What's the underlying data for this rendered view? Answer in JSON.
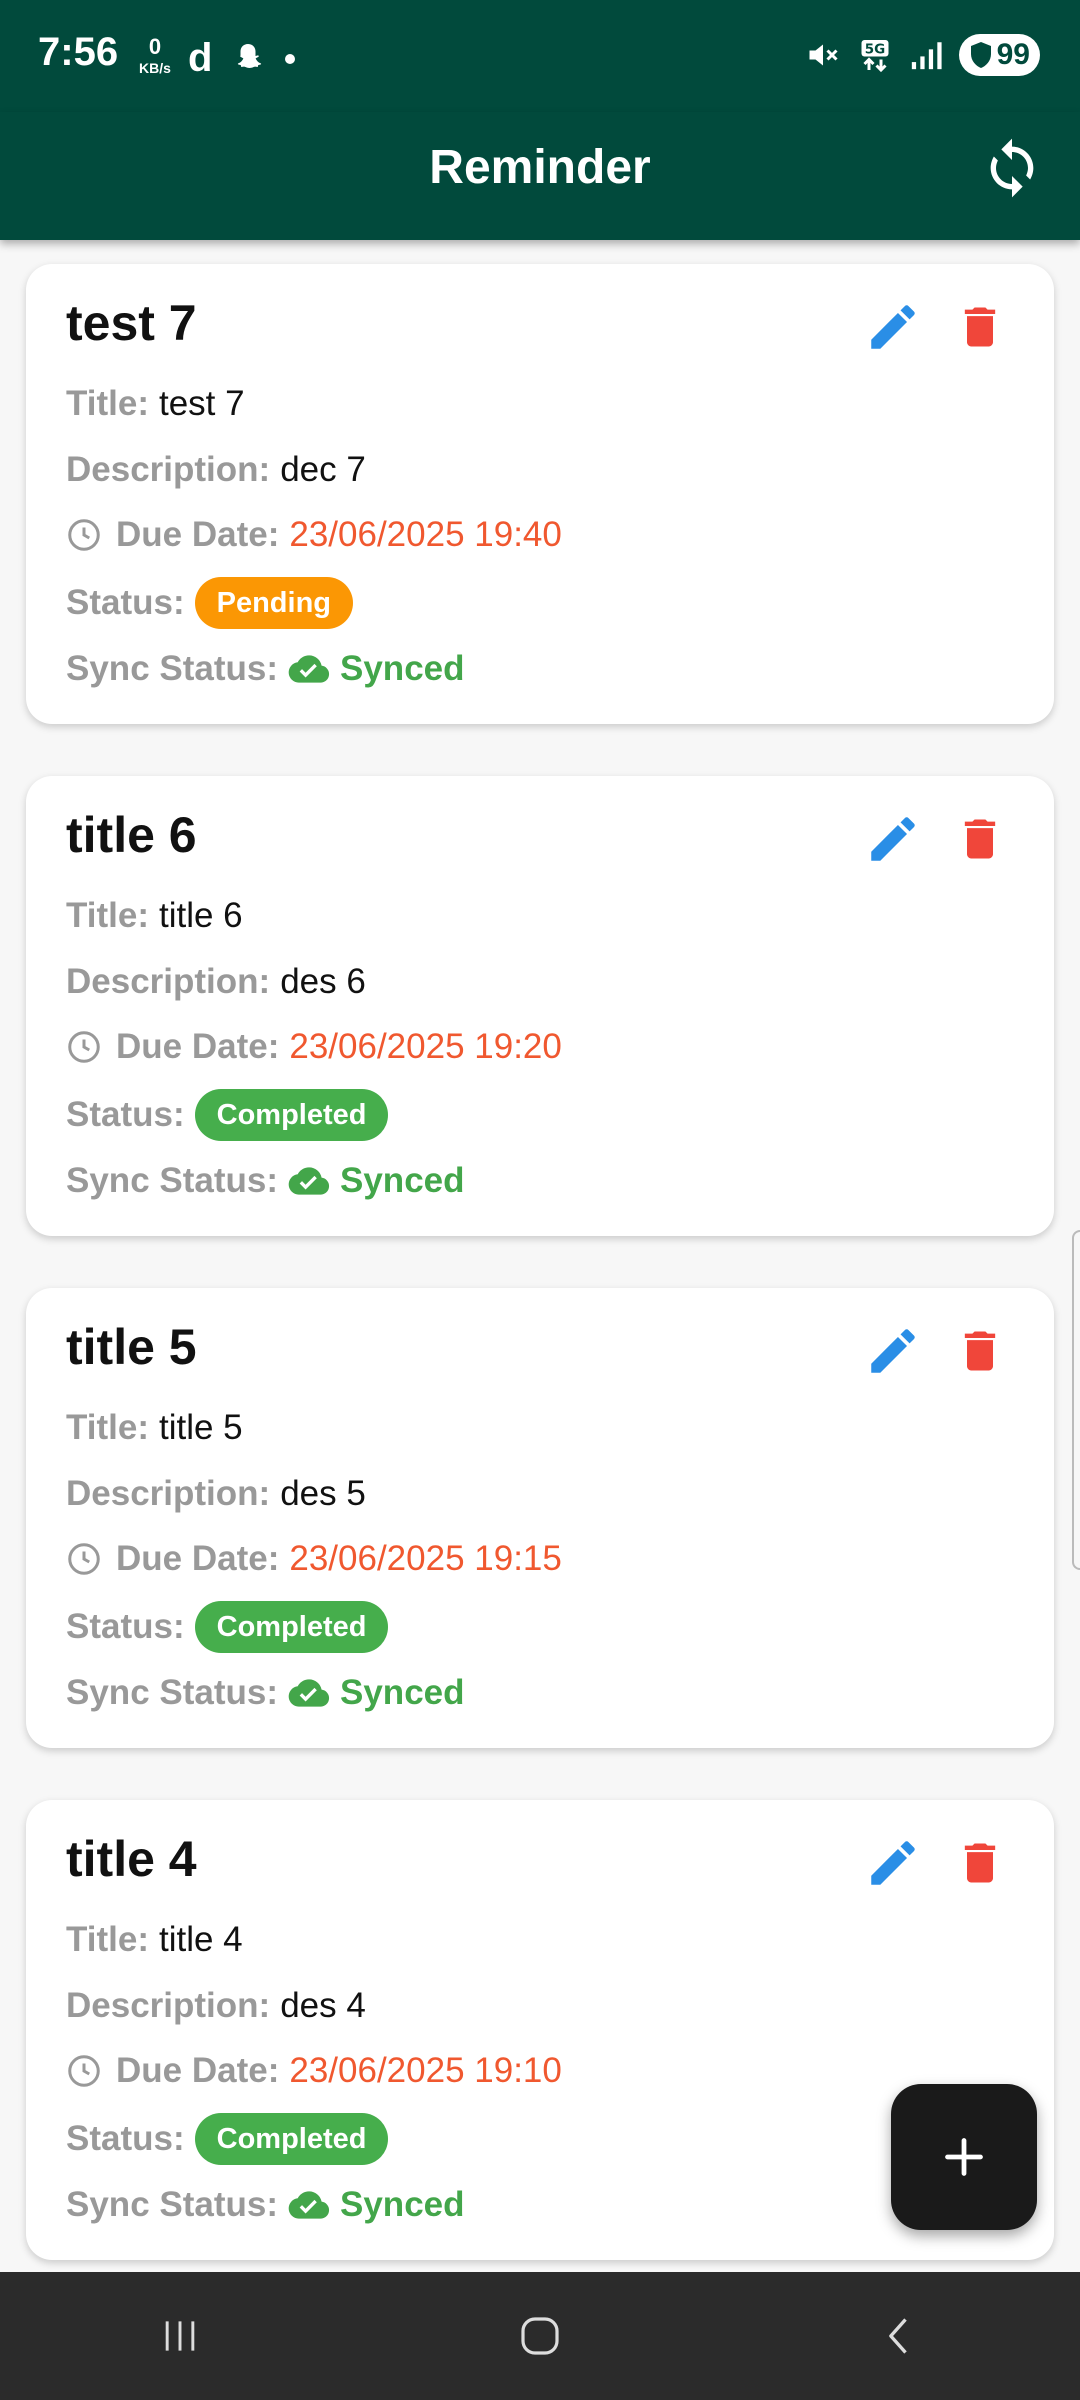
{
  "status_bar": {
    "time": "7:56",
    "net_speed_value": "0",
    "net_speed_unit": "KB/s",
    "battery": "99",
    "left_icons": [
      "d-app-icon",
      "snapchat-icon",
      "dot-icon"
    ],
    "right_icons": [
      "mute-icon",
      "5g-icon",
      "signal-icon",
      "battery-icon"
    ]
  },
  "app_bar": {
    "title": "Reminder",
    "action_icon": "sync-icon"
  },
  "labels": {
    "title": "Title:",
    "description": "Description:",
    "due_date": "Due Date:",
    "status": "Status:",
    "sync_status": "Sync Status:"
  },
  "reminders": [
    {
      "heading": "test 7",
      "title": "test 7",
      "description": "dec 7",
      "due_date": "23/06/2025 19:40",
      "status": "Pending",
      "sync_status": "Synced"
    },
    {
      "heading": "title 6",
      "title": "title 6",
      "description": "des 6",
      "due_date": "23/06/2025 19:20",
      "status": "Completed",
      "sync_status": "Synced"
    },
    {
      "heading": "title 5",
      "title": "title 5",
      "description": "des 5",
      "due_date": "23/06/2025 19:15",
      "status": "Completed",
      "sync_status": "Synced"
    },
    {
      "heading": "title 4",
      "title": "title 4",
      "description": "des 4",
      "due_date": "23/06/2025 19:10",
      "status": "Completed",
      "sync_status": "Synced"
    }
  ],
  "colors": {
    "app_bar": "#014a3c",
    "pending": "#fb9704",
    "completed": "#46ae4c",
    "due_date": "#f0582f",
    "edit": "#2a8ee6",
    "delete": "#f0463a",
    "synced": "#43a64a"
  },
  "fab_icon": "plus-icon",
  "nav_bar": [
    "recents-icon",
    "home-icon",
    "back-icon"
  ]
}
